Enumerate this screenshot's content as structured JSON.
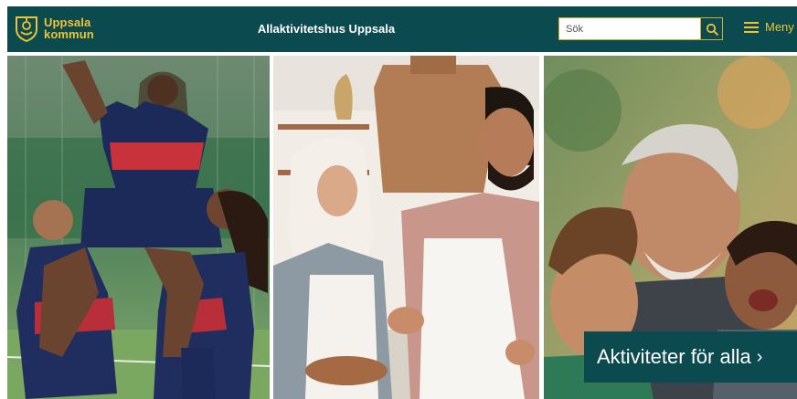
{
  "header": {
    "logo_line1": "Uppsala",
    "logo_line2": "kommun",
    "site_title": "Allaktivitetshus Uppsala",
    "search_placeholder": "Sök",
    "menu_label": "Meny"
  },
  "hero": {
    "cta_label": "Aktiviteter för alla",
    "cta_chevron": "›",
    "panels": [
      {
        "subject": "Girls in football kits celebrating on a pitch"
      },
      {
        "subject": "Two people baking together in a kitchen"
      },
      {
        "subject": "Grandfather laughing with two children"
      }
    ]
  },
  "colors": {
    "header_bg": "#0b4a4f",
    "accent_yellow": "#f2c230",
    "cta_bg": "#0b4a4f"
  },
  "icons": {
    "logo": "uppsala-crest-icon",
    "search": "search-icon",
    "menu": "hamburger-icon"
  }
}
